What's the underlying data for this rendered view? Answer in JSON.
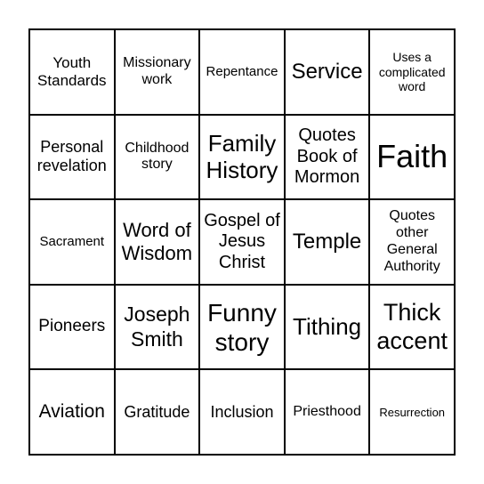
{
  "cells": [
    "Youth Standards",
    "Missionary work",
    "Repentance",
    "Service",
    "Uses a complicated word",
    "Personal revelation",
    "Childhood story",
    "Family History",
    "Quotes Book of Mormon",
    "Faith",
    "Sacrament",
    "Word of Wisdom",
    "Gospel of Jesus Christ",
    "Temple",
    "Quotes other General Authority",
    "Pioneers",
    "Joseph Smith",
    "Funny story",
    "Tithing",
    "Thick accent",
    "Aviation",
    "Gratitude",
    "Inclusion",
    "Priesthood",
    "Resurrection"
  ]
}
